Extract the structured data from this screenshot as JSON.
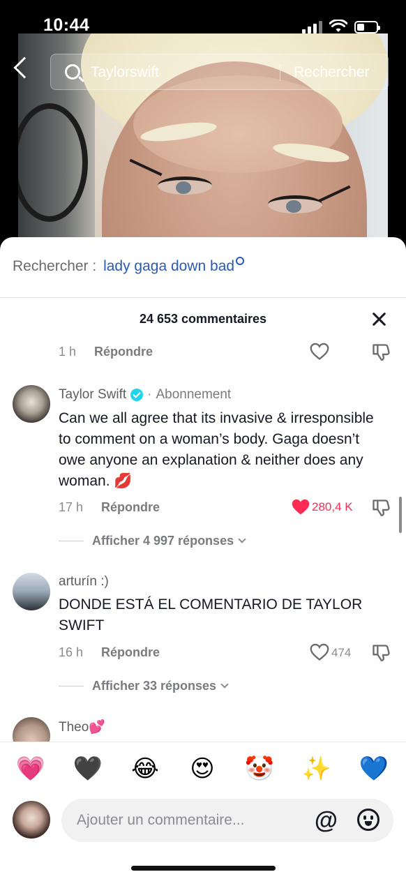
{
  "status_bar": {
    "time": "10:44"
  },
  "search": {
    "query": "Taylorswift",
    "submit_label": "Rechercher"
  },
  "sheet": {
    "suggestion_prefix": "Rechercher :",
    "suggestion_term": "lady gaga down bad",
    "comment_count": "24 653 commentaires"
  },
  "comments": [
    {
      "time": "1 h",
      "reply_label": "Répondre"
    },
    {
      "username": "Taylor Swift",
      "separator": "·",
      "follow_label": "Abonnement",
      "text": "Can we all agree that its invasive & irresponsible to comment on a woman’s body. Gaga doesn’t owe anyone an explanation & neither does any woman. 💋",
      "time": "17 h",
      "reply_label": "Répondre",
      "likes": "280,4 K",
      "view_replies": "Afficher 4 997 réponses"
    },
    {
      "username": "arturín :)",
      "text": "DONDE ESTÁ EL COMENTARIO DE TAYLOR SWIFT",
      "time": "16 h",
      "reply_label": "Répondre",
      "likes": "474",
      "view_replies": "Afficher 33 réponses"
    },
    {
      "username": "Theo💕"
    }
  ],
  "quick_emojis": [
    "💗",
    "🖤",
    "😂",
    "😍",
    "🤡",
    "✨",
    "💙"
  ],
  "composer": {
    "placeholder": "Ajouter un commentaire...",
    "mention_symbol": "@"
  },
  "colors": {
    "liked": "#fe2c55",
    "link": "#2b5ab5",
    "verified": "#20d5ec"
  }
}
